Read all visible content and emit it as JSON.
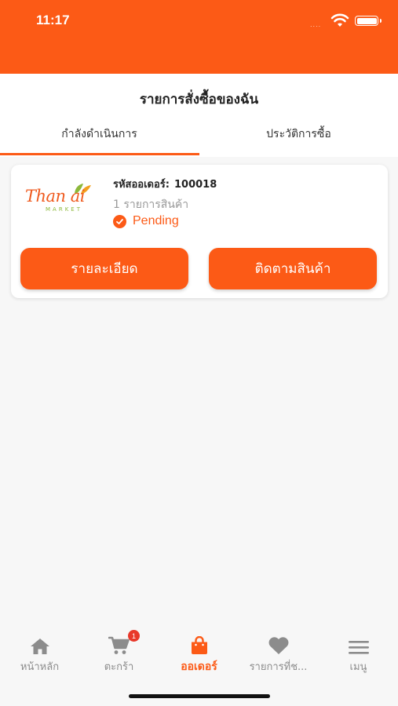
{
  "status_bar": {
    "time": "11:17",
    "signal": "....",
    "wifi_icon": "wifi-icon",
    "battery_icon": "battery-icon"
  },
  "header": {
    "title": "รายการสั่งซื้อของฉัน",
    "tabs": [
      {
        "label": "กำลังดำเนินการ",
        "active": true
      },
      {
        "label": "ประวัติการซื้อ",
        "active": false
      }
    ]
  },
  "order": {
    "logo_text": "ThanYai",
    "logo_subtext": "MARKET",
    "order_id_label": "รหัสออเดอร์:",
    "order_id": "100018",
    "item_count": "1 รายการสินค้า",
    "status": "Pending",
    "detail_button": "รายละเอียด",
    "track_button": "ติดตามสินค้า"
  },
  "tabbar": {
    "items": [
      {
        "label": "หน้าหลัก",
        "icon": "home-icon"
      },
      {
        "label": "ตะกร้า",
        "icon": "cart-icon",
        "badge": "1"
      },
      {
        "label": "ออเดอร์",
        "icon": "shopping-bag-icon",
        "active": true
      },
      {
        "label": "รายการที่ช...",
        "icon": "heart-icon"
      },
      {
        "label": "เมนู",
        "icon": "menu-icon"
      }
    ]
  },
  "colors": {
    "accent": "#fc5a16",
    "badge": "#e8382a",
    "inactive": "#8c8c8c"
  }
}
